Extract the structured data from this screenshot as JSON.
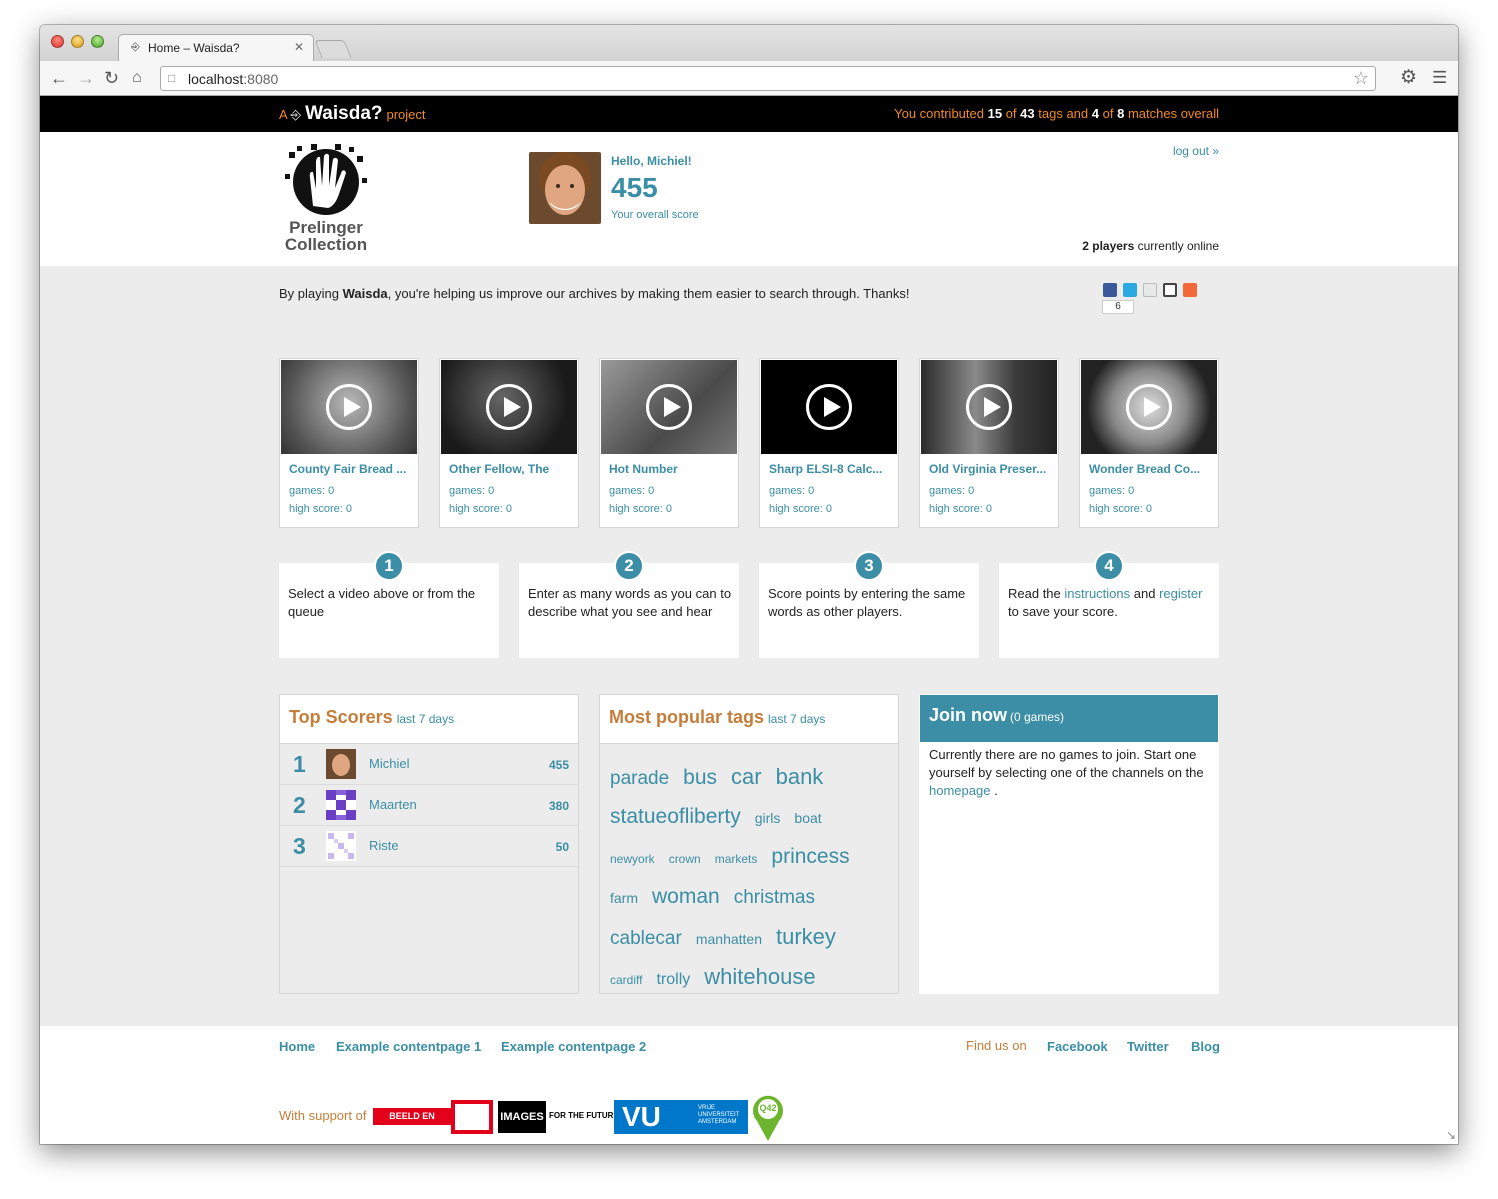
{
  "browser": {
    "tab_title": "Home – Waisda?",
    "url_host": "localhost",
    "url_port": ":8080"
  },
  "topbar": {
    "brand_prefix": "A",
    "brand_name": "Waisda?",
    "brand_suffix": "project",
    "contrib_1": "You contributed",
    "contrib_tags": "15",
    "contrib_of1": "of",
    "contrib_tags_total": "43",
    "contrib_2": "tags and",
    "contrib_matches": "4",
    "contrib_of2": "of",
    "contrib_matches_total": "8",
    "contrib_3": "matches overall"
  },
  "header": {
    "logo_line1": "Prelinger",
    "logo_line2": "Collection",
    "greeting": "Hello, Michiel!",
    "score": "455",
    "score_caption": "Your overall score",
    "logout": "log out »",
    "online_count": "2 players",
    "online_suffix": "currently online"
  },
  "intro": {
    "before": "By playing",
    "bold": "Waisda",
    "after": ", you're helping us improve our archives by making them easier to search through. Thanks!",
    "share_count": "6"
  },
  "videos": [
    {
      "title": "County Fair Bread ...",
      "games": "games: 0",
      "high": "high score: 0"
    },
    {
      "title": "Other Fellow, The",
      "games": "games: 0",
      "high": "high score: 0"
    },
    {
      "title": "Hot Number",
      "games": "games: 0",
      "high": "high score: 0"
    },
    {
      "title": "Sharp ELSI-8 Calc...",
      "games": "games: 0",
      "high": "high score: 0"
    },
    {
      "title": "Old Virginia Preser...",
      "games": "games: 0",
      "high": "high score: 0"
    },
    {
      "title": "Wonder Bread Co...",
      "games": "games: 0",
      "high": "high score: 0"
    }
  ],
  "steps": [
    {
      "num": "1",
      "text": "Select a video above or from the queue"
    },
    {
      "num": "2",
      "text": "Enter as many words as you can to describe what you see and hear"
    },
    {
      "num": "3",
      "text": "Score points by entering the same words as other players."
    },
    {
      "num": "4",
      "pre": "Read the",
      "link1": "instructions",
      "mid": "and",
      "link2": "register",
      "post": "to save your score."
    }
  ],
  "top_scorers": {
    "title": "Top Scorers",
    "period": "last 7 days",
    "rows": [
      {
        "rank": "1",
        "name": "Michiel",
        "points": "455"
      },
      {
        "rank": "2",
        "name": "Maarten",
        "points": "380"
      },
      {
        "rank": "3",
        "name": "Riste",
        "points": "50"
      }
    ]
  },
  "popular_tags": {
    "title": "Most popular tags",
    "period": "last 7 days",
    "tags": [
      "parade",
      "bus",
      "car",
      "bank",
      "statueofliberty",
      "girls",
      "boat",
      "newyork",
      "crown",
      "markets",
      "princess",
      "farm",
      "woman",
      "christmas",
      "cablecar",
      "manhatten",
      "turkey",
      "cardiff",
      "trolly",
      "whitehouse"
    ]
  },
  "join": {
    "title": "Join now",
    "count": "(0 games)",
    "text": "Currently there are no games to join. Start one yourself by selecting one of the channels on the",
    "link": "homepage",
    "end": "."
  },
  "footer": {
    "links": [
      "Home",
      "Example contentpage 1",
      "Example contentpage 2"
    ],
    "find_us": "Find us on",
    "social": [
      "Facebook",
      "Twitter",
      "Blog"
    ],
    "support": "With support of",
    "sponsor_beeld": "BEELD EN GELUID",
    "sponsor_images": "IMAGES",
    "sponsor_images_tag": "FOR THE FUTURE",
    "sponsor_vu": "VU",
    "sponsor_vu_sub1": "VRIJE",
    "sponsor_vu_sub2": "UNIVERSITEIT",
    "sponsor_vu_sub3": "AMSTERDAM",
    "sponsor_q42": "Q42"
  },
  "colors": {
    "accent": "#3b8ea5",
    "orange": "#f08a24",
    "heading": "#c57d3a"
  }
}
